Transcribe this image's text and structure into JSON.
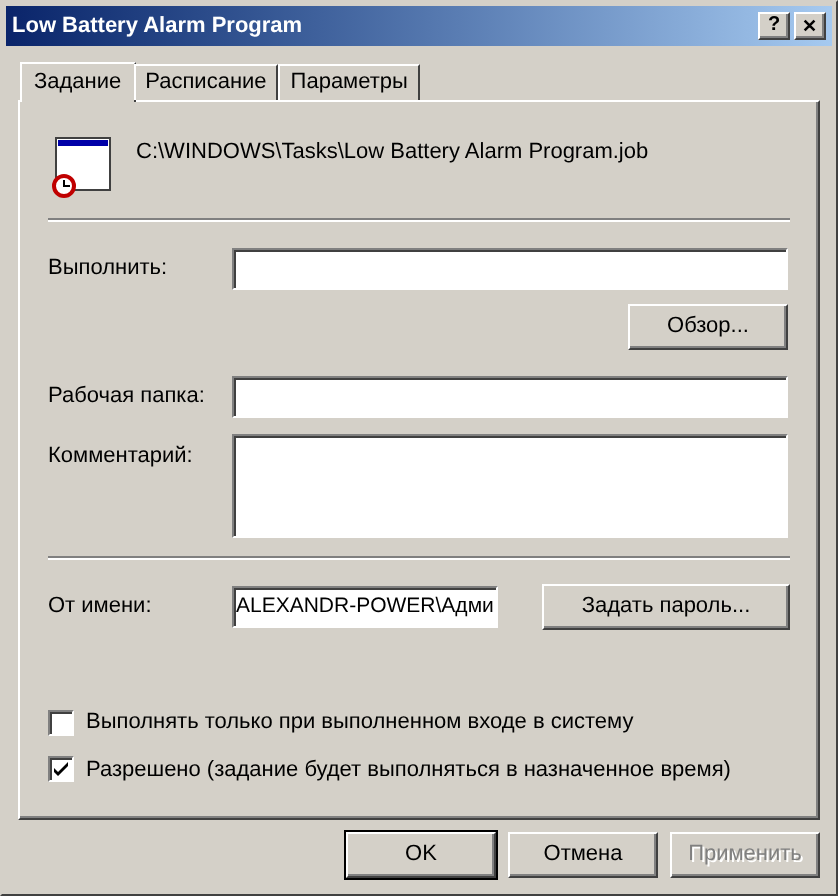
{
  "window": {
    "title": "Low Battery Alarm Program",
    "help": "?",
    "close": "✕"
  },
  "tabs": [
    {
      "label": "Задание",
      "selected": true
    },
    {
      "label": "Расписание",
      "selected": false
    },
    {
      "label": "Параметры",
      "selected": false
    }
  ],
  "task_path": "C:\\WINDOWS\\Tasks\\Low Battery Alarm Program.job",
  "run": {
    "label": "Выполнить:"
  },
  "browse_button": "Обзор...",
  "work_folder": {
    "label": "Рабочая папка:"
  },
  "comment": {
    "label": "Комментарий:"
  },
  "run_as": {
    "label": "От имени:",
    "value": "ALEXANDR-POWER\\Адми"
  },
  "set_password_button": "Задать пароль...",
  "options": [
    {
      "label": "Выполнять только при выполненном входе в систему",
      "checked": false
    },
    {
      "label": "Разрешено (задание будет выполняться в назначенное время)",
      "checked": true
    }
  ],
  "buttons": [
    {
      "label": "OK",
      "disabled": false,
      "default": true
    },
    {
      "label": "Отмена",
      "disabled": false,
      "default": false
    },
    {
      "label": "Применить",
      "disabled": true,
      "default": false
    }
  ]
}
